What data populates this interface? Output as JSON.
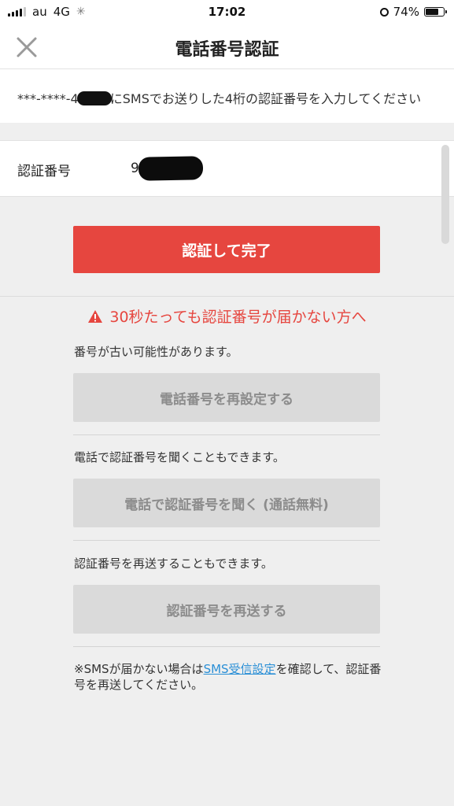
{
  "status_bar": {
    "carrier": "au",
    "network": "4G",
    "time": "17:02",
    "battery_percent": "74%",
    "battery_level": 0.74
  },
  "header": {
    "title": "電話番号認証",
    "close_icon": "close-icon"
  },
  "instruction": {
    "masked_prefix": "***-****-4",
    "text": "にSMSでお送りした4桁の認証番号を入力してください"
  },
  "code_field": {
    "label": "認証番号",
    "value": "9"
  },
  "primary_button": {
    "label": "認証して完了",
    "color": "#e6463f"
  },
  "help": {
    "heading": "30秒たっても認証番号が届かない方へ",
    "warning_icon": "warning-icon",
    "items": [
      {
        "text": "番号が古い可能性があります。",
        "button": "電話番号を再設定する"
      },
      {
        "text": "電話で認証番号を聞くこともできます。",
        "button": "電話で認証番号を聞く (通話無料)"
      },
      {
        "text": "認証番号を再送することもできます。",
        "button": "認証番号を再送する"
      }
    ]
  },
  "note": {
    "prefix": "※SMSが届かない場合は",
    "link": "SMS受信設定",
    "suffix": "を確認して、認証番号を再送してください。"
  }
}
